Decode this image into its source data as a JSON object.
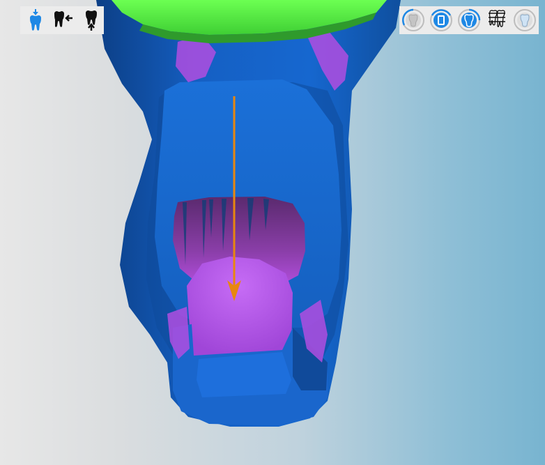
{
  "app": {
    "view": "3d-tooth-viewport"
  },
  "toolbar_left": {
    "tools": [
      {
        "icon": "tooth-insertion-direction-icon",
        "active": true
      },
      {
        "icon": "tooth-side-arrow-icon",
        "active": false
      },
      {
        "icon": "tooth-bottom-arrow-icon",
        "active": false
      }
    ]
  },
  "toolbar_right": {
    "tools": [
      {
        "icon": "tooth-crown-ring-icon",
        "active": false
      },
      {
        "icon": "tooth-inlay-icon",
        "active": true
      },
      {
        "icon": "tooth-blue-crown-icon",
        "active": true
      },
      {
        "icon": "bridge-icon",
        "active": false
      },
      {
        "icon": "tooth-outline-ring-icon",
        "active": false
      }
    ]
  },
  "colors": {
    "accent": "#1e88e5",
    "model_blue": "#1565c0",
    "margin_green": "#5cf046",
    "undercut_purple": "#b04ee0",
    "insertion_arrow": "#e8870f"
  }
}
